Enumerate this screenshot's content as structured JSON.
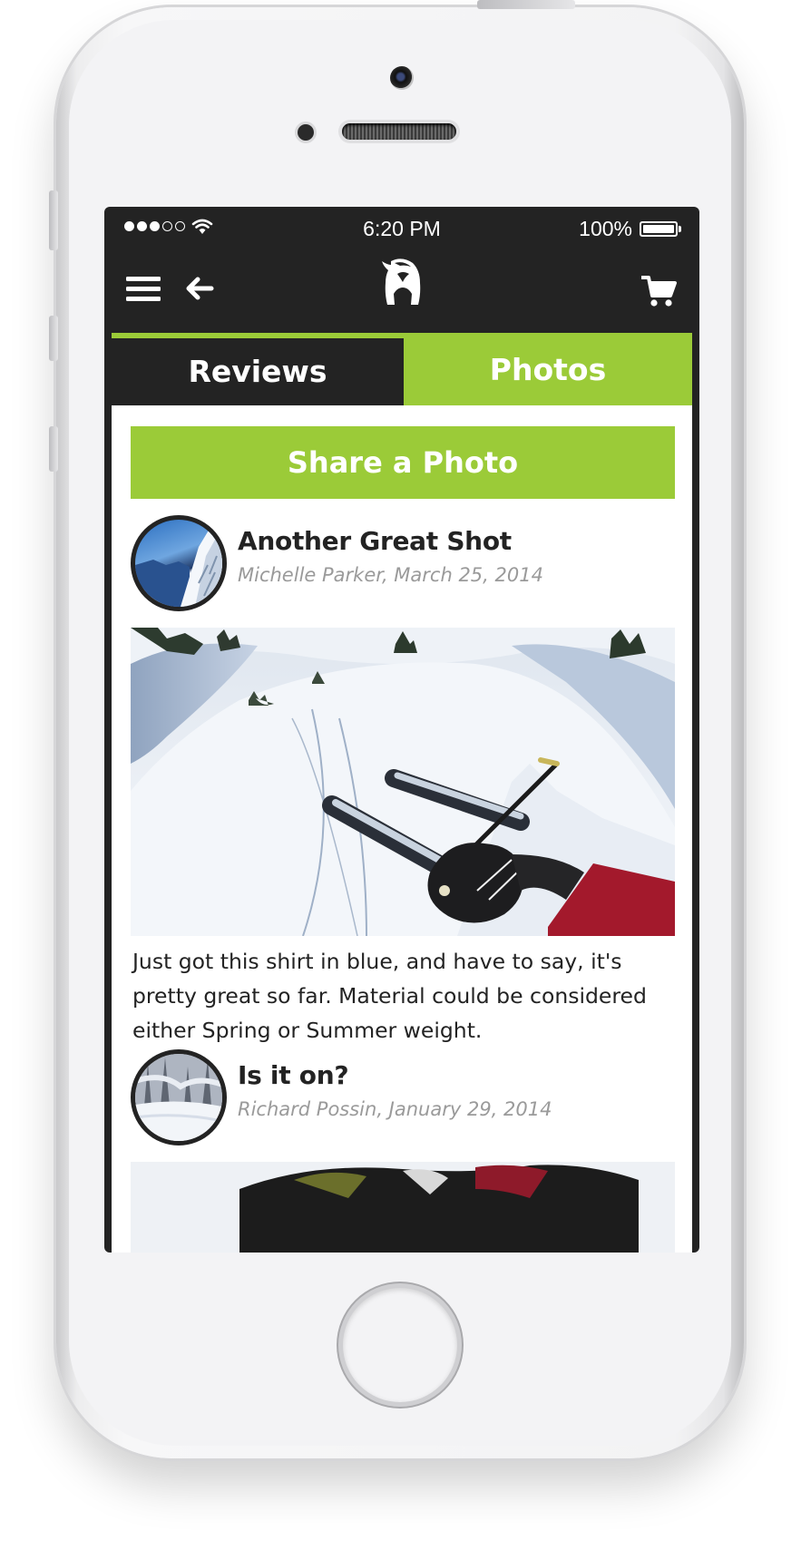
{
  "status_bar": {
    "signal": "signal-dots",
    "wifi": "wifi-icon",
    "time": "6:20 PM",
    "battery_percent": "100%",
    "battery_level": 1.0
  },
  "nav": {
    "menu_icon": "hamburger-menu-icon",
    "back_icon": "arrow-left-icon",
    "logo": "goat-logo",
    "cart_icon": "shopping-cart-icon"
  },
  "tabs": [
    {
      "label": "Reviews",
      "selected": false
    },
    {
      "label": "Photos",
      "selected": true
    }
  ],
  "share_button": {
    "label": "Share a Photo"
  },
  "posts": [
    {
      "title": "Another Great Shot",
      "author": "Michelle Parker",
      "date": "March 25, 2014",
      "byline": "Michelle Parker,  March 25, 2014",
      "body": "Just got this shirt in blue, and have to say, it's pretty great so far. Material could be considered either Spring or Summer weight."
    },
    {
      "title": "Is it on?",
      "author": "Richard Possin",
      "date": "January 29, 2014",
      "byline": "Richard Possin,  January 29, 2014"
    }
  ],
  "colors": {
    "accent_green": "#9bcb38",
    "dark": "#232323",
    "meta_gray": "#9a9a9a",
    "white": "#ffffff"
  }
}
